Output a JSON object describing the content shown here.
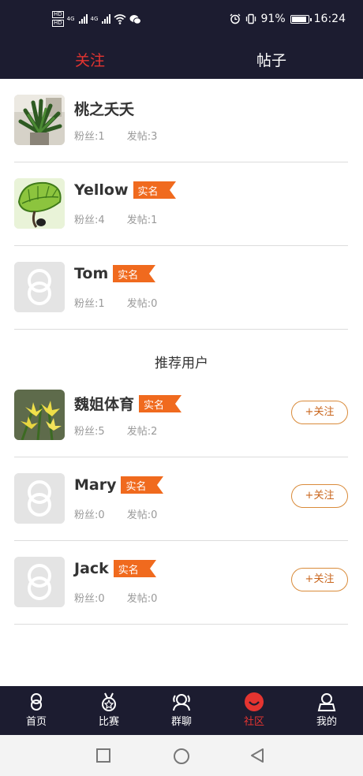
{
  "status_bar": {
    "hd1": "HD",
    "hd2": "HD",
    "net1": "4G",
    "net2": "4G",
    "battery_pct_text": "91%",
    "battery_level": 0.91,
    "time": "16:24"
  },
  "top_tabs": [
    {
      "label": "关注",
      "active": true
    },
    {
      "label": "帖子",
      "active": false
    }
  ],
  "followed_users": [
    {
      "name": "桃之夭夭",
      "verified": false,
      "fans": "粉丝:1",
      "posts": "发帖:3",
      "avatar": "plant-photo"
    },
    {
      "name": "Yellow",
      "verified": true,
      "badge": "实名",
      "fans": "粉丝:4",
      "posts": "发帖:1",
      "avatar": "leaf-photo"
    },
    {
      "name": "Tom",
      "verified": true,
      "badge": "实名",
      "fans": "粉丝:1",
      "posts": "发帖:0",
      "avatar": "default-avatar-icon"
    }
  ],
  "recommend_heading": "推荐用户",
  "recommended_users": [
    {
      "name": "魏姐体育",
      "verified": true,
      "badge": "实名",
      "fans": "粉丝:5",
      "posts": "发帖:2",
      "follow": "+关注",
      "avatar": "lily-photo"
    },
    {
      "name": "Mary",
      "verified": true,
      "badge": "实名",
      "fans": "粉丝:0",
      "posts": "发帖:0",
      "follow": "+关注",
      "avatar": "default-avatar-icon"
    },
    {
      "name": "Jack",
      "verified": true,
      "badge": "实名",
      "fans": "粉丝:0",
      "posts": "发帖:0",
      "follow": "+关注",
      "avatar": "default-avatar-icon"
    }
  ],
  "bottom_nav": [
    {
      "label": "首页",
      "icon": "home-icon",
      "active": false
    },
    {
      "label": "比赛",
      "icon": "medal-icon",
      "active": false
    },
    {
      "label": "群聊",
      "icon": "group-chat-icon",
      "active": false
    },
    {
      "label": "社区",
      "icon": "community-icon",
      "active": true
    },
    {
      "label": "我的",
      "icon": "profile-icon",
      "active": false
    }
  ],
  "colors": {
    "dark_bar": "#1c1c30",
    "accent_red": "#e43430",
    "badge_orange": "#f06a1e",
    "follow_orange": "#d98b3a"
  }
}
